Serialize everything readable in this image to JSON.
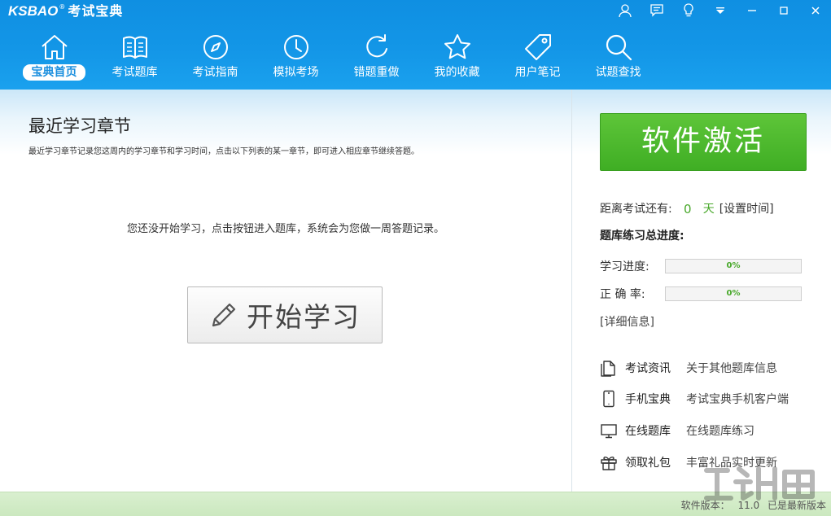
{
  "app": {
    "logo_en": "KSBAO",
    "logo_reg": "®",
    "logo_cn": "考试宝典"
  },
  "window_controls": [
    {
      "name": "user-icon"
    },
    {
      "name": "message-icon"
    },
    {
      "name": "bulb-icon"
    },
    {
      "name": "dropdown-icon"
    },
    {
      "name": "minimize-icon"
    },
    {
      "name": "maximize-icon"
    },
    {
      "name": "close-icon"
    }
  ],
  "nav": [
    {
      "label": "宝典首页",
      "icon": "home-icon",
      "active": true
    },
    {
      "label": "考试题库",
      "icon": "book-icon",
      "active": false
    },
    {
      "label": "考试指南",
      "icon": "compass-icon",
      "active": false
    },
    {
      "label": "模拟考场",
      "icon": "clock-icon",
      "active": false
    },
    {
      "label": "错题重做",
      "icon": "refresh-icon",
      "active": false
    },
    {
      "label": "我的收藏",
      "icon": "star-icon",
      "active": false
    },
    {
      "label": "用户笔记",
      "icon": "tag-icon",
      "active": false
    },
    {
      "label": "试题查找",
      "icon": "search-icon",
      "active": false
    }
  ],
  "recent": {
    "title": "最近学习章节",
    "description": "最近学习章节记录您这周内的学习章节和学习时间，点击以下列表的某一章节，即可进入相应章节继续答题。",
    "empty_message": "您还没开始学习，点击按钮进入题库，系统会为您做一周答题记录。",
    "start_button": "开始学习",
    "start_icon": "pencil-icon"
  },
  "side": {
    "activate_button": "软件激活",
    "countdown_label": "距离考试还有:",
    "countdown_days": "0",
    "countdown_unit": "天",
    "set_time_link": "[设置时间]",
    "progress_title": "题库练习总进度:",
    "study_label": "学习进度:",
    "study_value": "0%",
    "study_fraction": 0,
    "accuracy_label": "正 确 率:",
    "accuracy_value": "0%",
    "accuracy_fraction": 0,
    "detail_link": "[详细信息]",
    "links": [
      {
        "name": "考试资讯",
        "desc": "关于其他题库信息",
        "icon": "document-icon"
      },
      {
        "name": "手机宝典",
        "desc": "考试宝典手机客户端",
        "icon": "phone-icon"
      },
      {
        "name": "在线题库",
        "desc": "在线题库练习",
        "icon": "monitor-icon"
      },
      {
        "name": "领取礼包",
        "desc": "丰富礼品实时更新",
        "icon": "gift-icon"
      }
    ]
  },
  "status": {
    "version_label": "软件版本：",
    "version_value": "11.0",
    "version_note": "已是最新版本"
  },
  "colors": {
    "header_blue": "#1396e7",
    "accent_green": "#48a82a",
    "activate_green": "#4fba2e"
  }
}
